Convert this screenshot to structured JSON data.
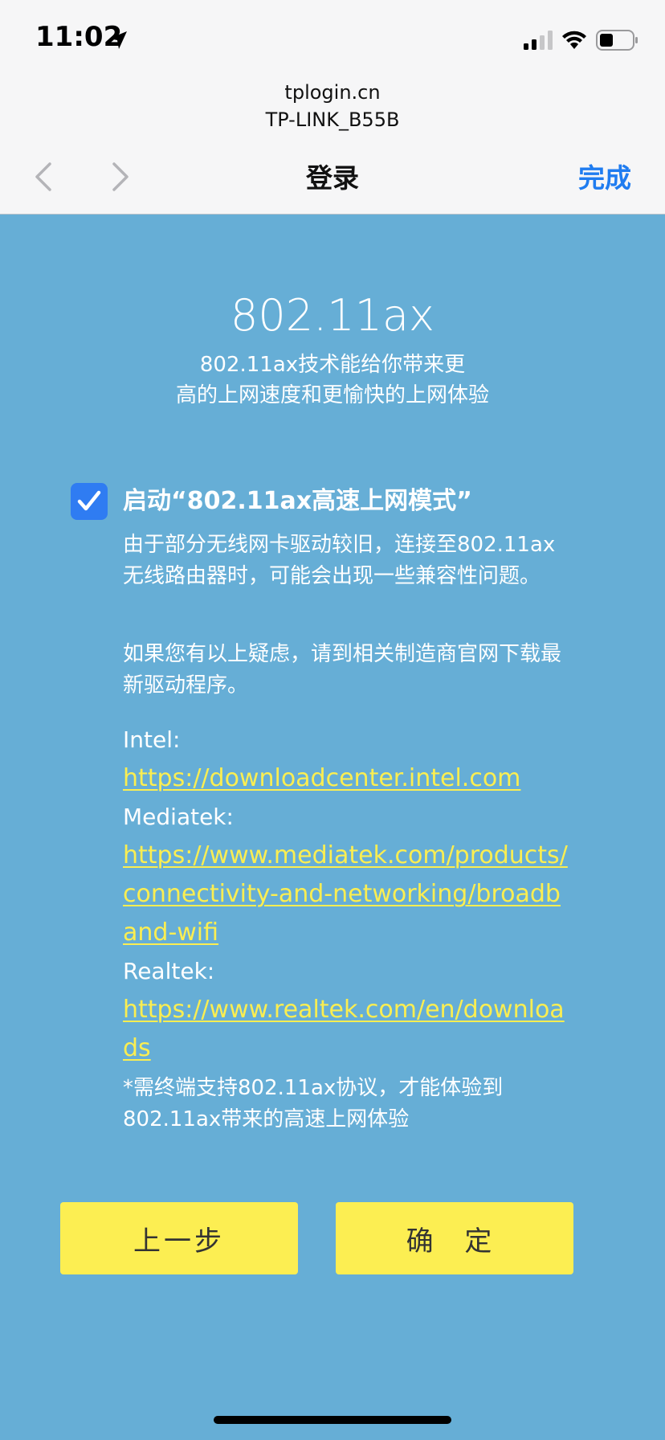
{
  "status_bar": {
    "time": "11:02",
    "icons": [
      "location-arrow-icon",
      "signal-icon",
      "wifi-icon",
      "battery-icon"
    ]
  },
  "browser": {
    "domain": "tplogin.cn",
    "ssid": "TP-LINK_B55B",
    "title": "登录",
    "done_label": "完成",
    "accent_color": "#1f7cf0"
  },
  "hero": {
    "title": "802.11ax",
    "subtitle_line1": "802.11ax技术能给你带来更",
    "subtitle_line2": "高的上网速度和更愉快的上网体验"
  },
  "option": {
    "checked": true,
    "label": "启动“802.11ax高速上网模式”",
    "para1": "由于部分无线网卡驱动较旧，连接至802.11ax无线路由器时，可能会出现一些兼容性问题。",
    "para2": "如果您有以上疑虑，请到相关制造商官网下载最新驱动程序。"
  },
  "vendors": [
    {
      "name": "Intel:",
      "url": "https://downloadcenter.intel.com"
    },
    {
      "name": "Mediatek:",
      "url": "https://www.mediatek.com/products/connectivity-and-networking/broadband-wifi"
    },
    {
      "name": "Realtek:",
      "url": "https://www.realtek.com/en/downloads"
    }
  ],
  "note": "*需终端支持802.11ax协议，才能体验到802.11ax带来的高速上网体验",
  "buttons": {
    "prev": "上一步",
    "ok": "确 定"
  },
  "colors": {
    "background": "#66aed6",
    "button": "#fcee52",
    "link": "#fbee51",
    "checkbox": "#2f7cf2"
  }
}
